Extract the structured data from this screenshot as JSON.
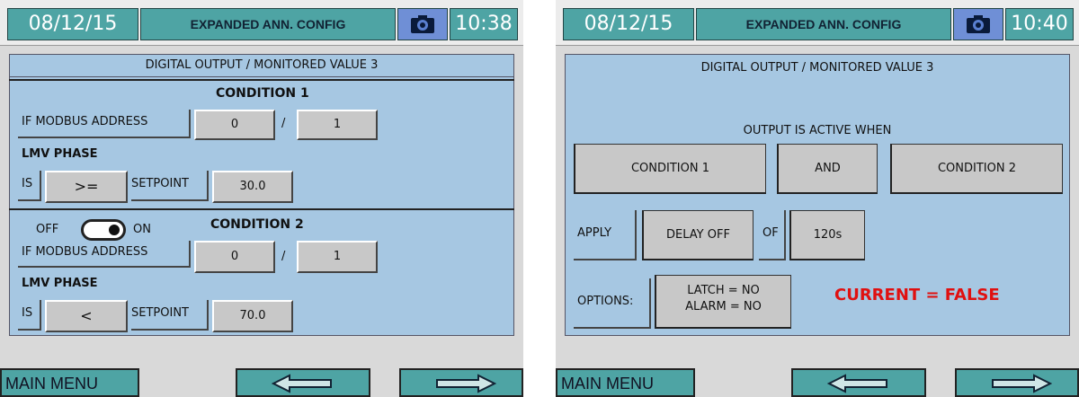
{
  "left": {
    "header": {
      "date": "08/12/15",
      "title": "EXPANDED ANN. CONFIG",
      "time": "10:38"
    },
    "banner": "DIGITAL OUTPUT / MONITORED VALUE 3",
    "condition1": {
      "title": "CONDITION 1",
      "modbus_label": "IF MODBUS ADDRESS",
      "addr": "0",
      "slash": "/",
      "sub": "1",
      "phase_label": "LMV PHASE",
      "is_label": "IS",
      "operator": ">=",
      "setpoint_label": "SETPOINT",
      "setpoint": "30.0"
    },
    "condition2": {
      "off_label": "OFF",
      "on_label": "ON",
      "title": "CONDITION 2",
      "modbus_label": "IF MODBUS ADDRESS",
      "addr": "0",
      "slash": "/",
      "sub": "1",
      "phase_label": "LMV PHASE",
      "is_label": "IS",
      "operator": "<",
      "setpoint_label": "SETPOINT",
      "setpoint": "70.0"
    },
    "footer": {
      "main_menu": "MAIN MENU"
    }
  },
  "right": {
    "header": {
      "date": "08/12/15",
      "title": "EXPANDED ANN. CONFIG",
      "time": "10:40"
    },
    "banner": "DIGITAL OUTPUT / MONITORED VALUE 3",
    "active_when": "OUTPUT IS ACTIVE WHEN",
    "cond1": "CONDITION 1",
    "logic": "AND",
    "cond2": "CONDITION 2",
    "apply_label": "APPLY",
    "delay": "DELAY OFF",
    "of_label": "OF",
    "delay_time": "120s",
    "options_label": "OPTIONS:",
    "latch": "LATCH = NO",
    "alarm": "ALARM = NO",
    "current": "CURRENT = FALSE",
    "footer": {
      "main_menu": "MAIN MENU"
    }
  },
  "colors": {
    "teal": "#4ea4a4",
    "panel": "#a6c7e2",
    "field": "#c8c8c8",
    "alert": "#e01010"
  },
  "icons": {
    "camera": "camera-icon",
    "back": "left-arrow-icon",
    "next": "right-arrow-icon"
  }
}
